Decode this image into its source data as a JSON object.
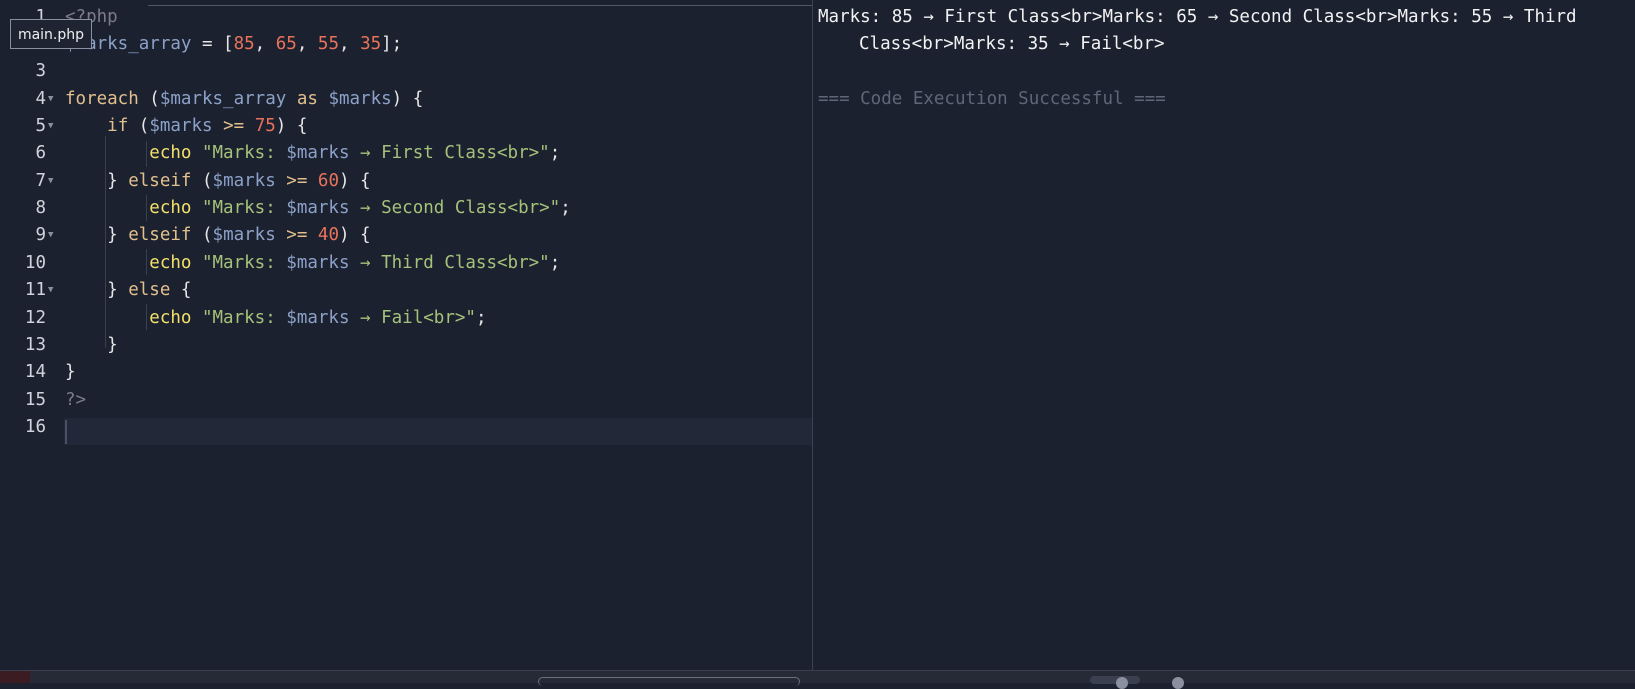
{
  "editor": {
    "file_tab": "main.php",
    "line_numbers": [
      "1",
      "2",
      "3",
      "4",
      "5",
      "6",
      "7",
      "8",
      "9",
      "10",
      "11",
      "12",
      "13",
      "14",
      "15",
      "16"
    ],
    "code": {
      "l1_open": "<?php",
      "l2_var": "$marks_array",
      "l2_eq": " = [",
      "l2_n1": "85",
      "l2_c1": ", ",
      "l2_n2": "65",
      "l2_c2": ", ",
      "l2_n3": "55",
      "l2_c3": ", ",
      "l2_n4": "35",
      "l2_end": "];",
      "l4_kw": "foreach",
      "l4_p1": " (",
      "l4_v1": "$marks_array",
      "l4_as": " as ",
      "l4_v2": "$marks",
      "l4_end": ") {",
      "l5_kw": "if",
      "l5_p1": " (",
      "l5_v": "$marks",
      "l5_op": " >= ",
      "l5_n": "75",
      "l5_end": ") {",
      "echo": "echo",
      "l6_s1": " \"Marks: ",
      "l6_v": "$marks",
      "l6_s2": " → First Class<br>\"",
      "l6_end": ";",
      "l7_b": "} ",
      "l7_kw": "elseif",
      "l7_p1": " (",
      "l7_v": "$marks",
      "l7_op": " >= ",
      "l7_n": "60",
      "l7_end": ") {",
      "l8_s1": " \"Marks: ",
      "l8_v": "$marks",
      "l8_s2": " → Second Class<br>\"",
      "l8_end": ";",
      "l9_b": "} ",
      "l9_kw": "elseif",
      "l9_p1": " (",
      "l9_v": "$marks",
      "l9_op": " >= ",
      "l9_n": "40",
      "l9_end": ") {",
      "l10_s1": " \"Marks: ",
      "l10_v": "$marks",
      "l10_s2": " → Third Class<br>\"",
      "l10_end": ";",
      "l11_b": "} ",
      "l11_kw": "else",
      "l11_end": " {",
      "l12_s1": " \"Marks: ",
      "l12_v": "$marks",
      "l12_s2": " → Fail<br>\"",
      "l12_end": ";",
      "l13": "}",
      "l14": "}",
      "l15_close": "?>"
    }
  },
  "output": {
    "line1": "Marks: 85 → First Class<br>Marks: 65 → Second Class<br>Marks: 55 → Third",
    "line2": "Class<br>Marks: 35 → Fail<br>",
    "status": "=== Code Execution Successful ==="
  },
  "colors": {
    "background": "#1c2130",
    "keyword": "#e2c08d",
    "variable": "#8ca1c7",
    "number": "#e8735a",
    "string": "#a5c27a",
    "echo": "#f2e06b"
  }
}
